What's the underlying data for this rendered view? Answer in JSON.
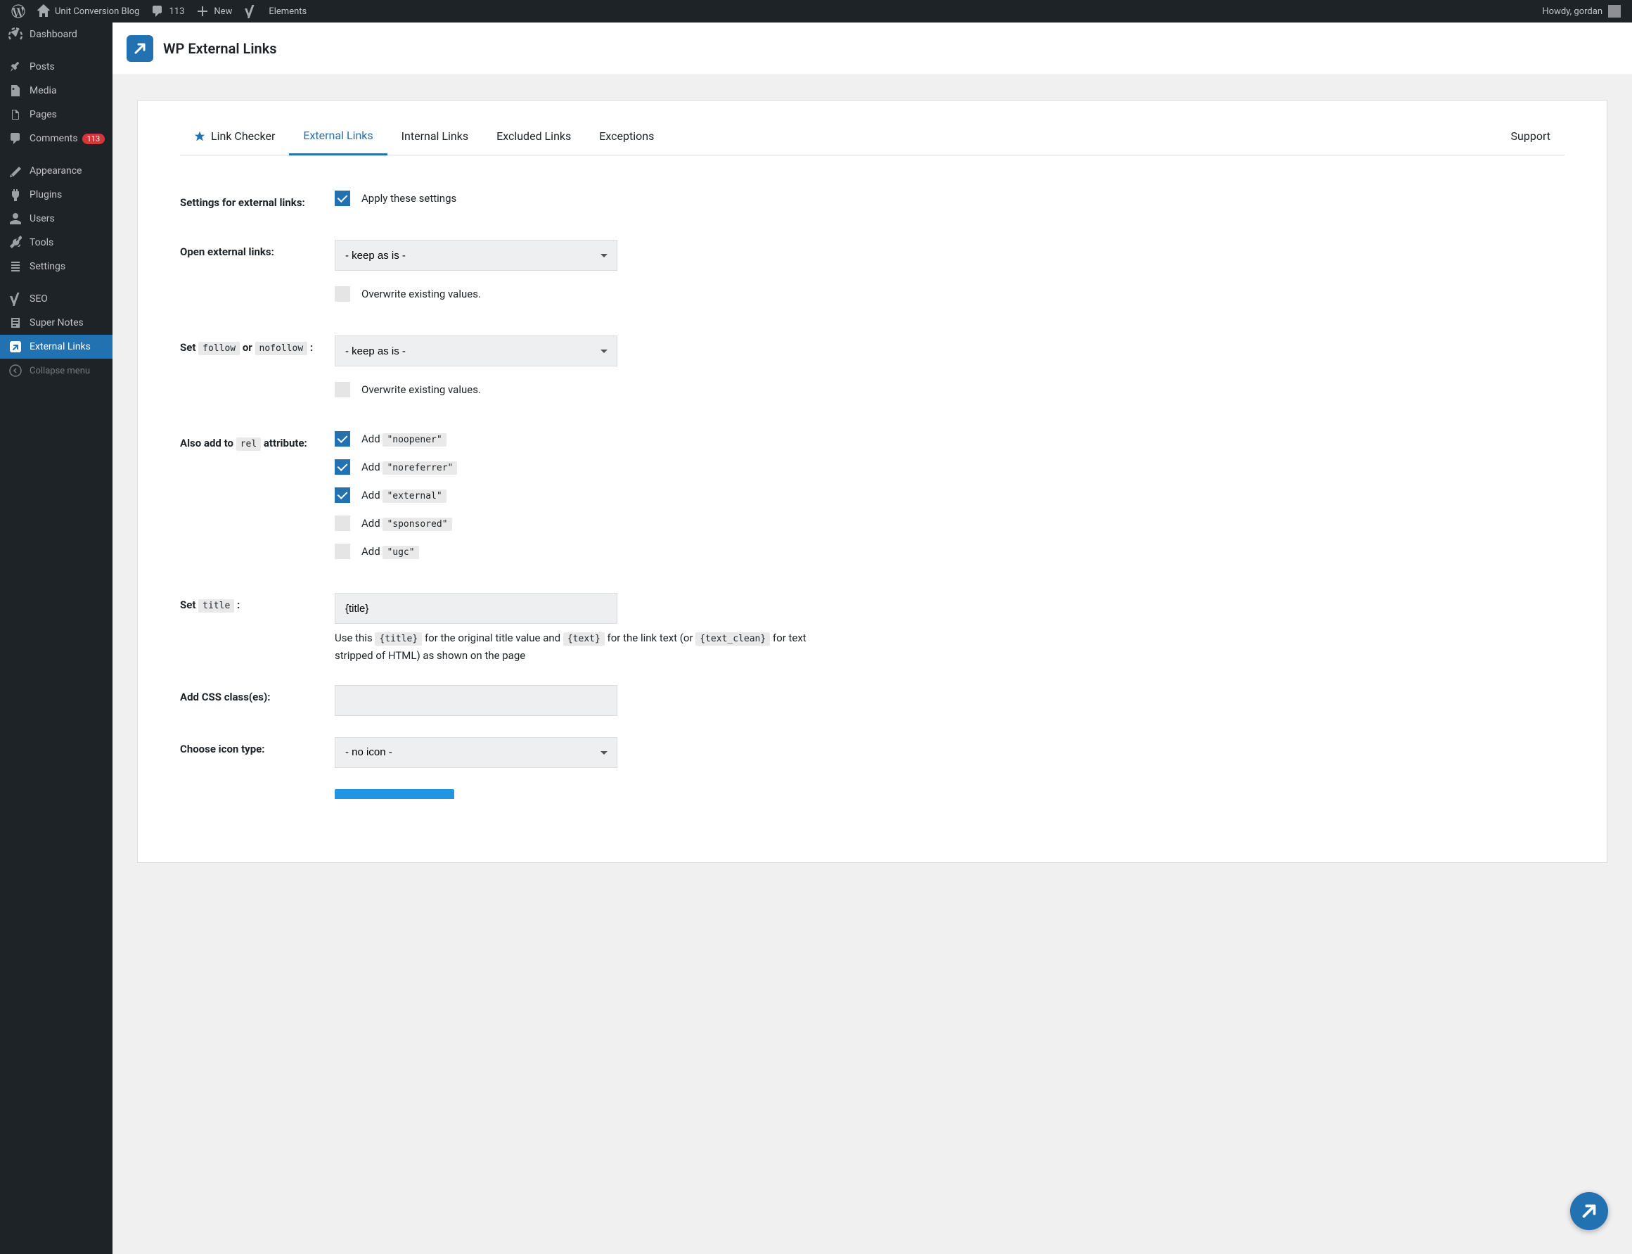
{
  "adminbar": {
    "site_name": "Unit Conversion Blog",
    "comments_count": "113",
    "new_label": "New",
    "elements_label": "Elements",
    "howdy": "Howdy, gordan"
  },
  "sidemenu": {
    "dashboard": "Dashboard",
    "posts": "Posts",
    "media": "Media",
    "pages": "Pages",
    "comments": "Comments",
    "comments_count": "113",
    "appearance": "Appearance",
    "plugins": "Plugins",
    "users": "Users",
    "tools": "Tools",
    "settings": "Settings",
    "seo": "SEO",
    "super_notes": "Super Notes",
    "external_links": "External Links",
    "collapse": "Collapse menu"
  },
  "page": {
    "title": "WP External Links"
  },
  "tabs": {
    "link_checker": "Link Checker",
    "external": "External Links",
    "internal": "Internal Links",
    "excluded": "Excluded Links",
    "exceptions": "Exceptions",
    "support": "Support"
  },
  "form": {
    "settings_label": "Settings for external links:",
    "apply_label": "Apply these settings",
    "open_label": "Open external links:",
    "keep_as_is": "- keep as is -",
    "overwrite_label": "Overwrite existing values.",
    "set_follow_pre": "Set ",
    "follow_code": "follow",
    "or_text": " or ",
    "nofollow_code": "nofollow",
    "colon": " :",
    "also_add_pre": "Also add to ",
    "rel_code": "rel",
    "also_add_post": " attribute:",
    "add_word": "Add ",
    "noopener": "\"noopener\"",
    "noreferrer": "\"noreferrer\"",
    "external": "\"external\"",
    "sponsored": "\"sponsored\"",
    "ugc": "\"ugc\"",
    "set_title_pre": "Set ",
    "title_code": "title",
    "title_value": "{title}",
    "desc1": "Use this ",
    "desc1_code": "{title}",
    "desc2": " for the original title value and ",
    "desc2_code": "{text}",
    "desc3": " for the link text (or ",
    "desc3_code": "{text_clean}",
    "desc4": " for text stripped of HTML) as shown on the page",
    "css_label": "Add CSS class(es):",
    "css_value": "",
    "icon_label": "Choose icon type:",
    "no_icon": "- no icon -"
  }
}
